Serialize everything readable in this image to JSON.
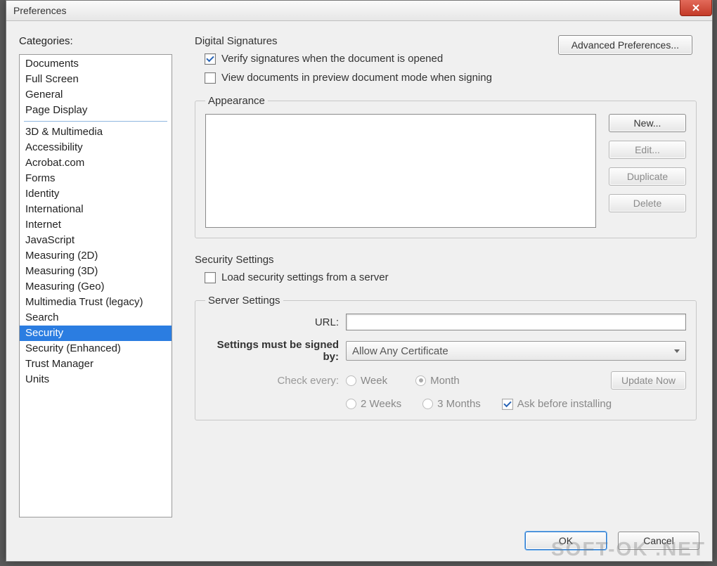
{
  "window": {
    "title": "Preferences",
    "close_icon": "close-icon"
  },
  "sidebar": {
    "label": "Categories:",
    "group1": [
      "Documents",
      "Full Screen",
      "General",
      "Page Display"
    ],
    "group2": [
      "3D & Multimedia",
      "Accessibility",
      "Acrobat.com",
      "Forms",
      "Identity",
      "International",
      "Internet",
      "JavaScript",
      "Measuring (2D)",
      "Measuring (3D)",
      "Measuring (Geo)",
      "Multimedia Trust (legacy)",
      "Search",
      "Security",
      "Security (Enhanced)",
      "Trust Manager",
      "Units"
    ],
    "selected": "Security"
  },
  "digitalSignatures": {
    "title": "Digital Signatures",
    "verify_checked": true,
    "verify_label": "Verify signatures when the document is opened",
    "previewmode_checked": false,
    "previewmode_label": "View documents in preview document mode when signing",
    "advanced_btn": "Advanced Preferences...",
    "appearance": {
      "legend": "Appearance",
      "buttons": {
        "new": "New...",
        "edit": "Edit...",
        "duplicate": "Duplicate",
        "delete": "Delete"
      }
    }
  },
  "securitySettings": {
    "title": "Security Settings",
    "load_checked": false,
    "load_label": "Load security settings from a server",
    "server": {
      "legend": "Server Settings",
      "url_label": "URL:",
      "url_value": "",
      "signedby_label": "Settings must be signed by:",
      "signedby_value": "Allow Any Certificate",
      "checkevery_label": "Check every:",
      "options": {
        "week": "Week",
        "twoweeks": "2 Weeks",
        "month": "Month",
        "threemonths": "3 Months"
      },
      "selected_period": "Month",
      "ask_label": "Ask before installing",
      "ask_checked": true,
      "update_btn": "Update Now"
    }
  },
  "footer": {
    "ok": "OK",
    "cancel": "Cancel"
  },
  "watermark": "SOFT-OK .NET"
}
